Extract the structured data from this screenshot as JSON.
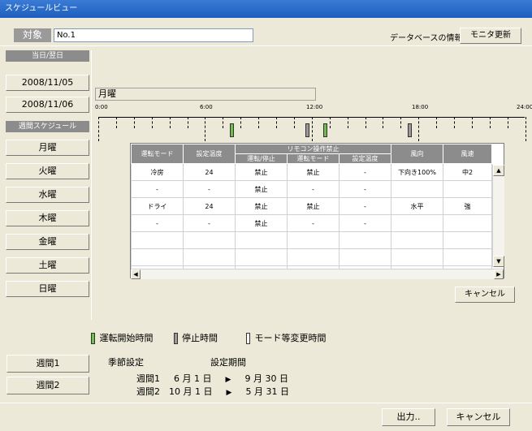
{
  "window": {
    "title": "スケジュールビュー"
  },
  "toolbar": {
    "target_label": "対象",
    "target_value": "No.1",
    "db_info_label": "データベースの情報",
    "monitor_update_label": "モニタ更新"
  },
  "sidebar": {
    "date_header": "当日/翌日",
    "dates": [
      "2008/11/05",
      "2008/11/06"
    ],
    "week_header": "週間スケジュール",
    "days": [
      "月曜",
      "火曜",
      "水曜",
      "木曜",
      "金曜",
      "土曜",
      "日曜"
    ]
  },
  "main": {
    "selected_day": "月曜",
    "timeline": {
      "labels": [
        "0:00",
        "6:00",
        "12:00",
        "18:00",
        "24:00"
      ],
      "start_markers_hours": [
        7.5,
        12.75
      ],
      "stop_markers_hours": [
        11.75,
        17.5
      ]
    },
    "table": {
      "headers_top": [
        "運転モード",
        "設定温度",
        "リモコン操作禁止",
        "風向",
        "風速"
      ],
      "headers_sub": [
        "運転/停止",
        "運転モード",
        "設定温度"
      ],
      "rows": [
        [
          "冷房",
          "24",
          "禁止",
          "禁止",
          "-",
          "下向き100%",
          "中2"
        ],
        [
          "-",
          "-",
          "禁止",
          "-",
          "-",
          "",
          ""
        ],
        [
          "ドライ",
          "24",
          "禁止",
          "禁止",
          "-",
          "水平",
          "強"
        ],
        [
          "-",
          "-",
          "禁止",
          "-",
          "-",
          "",
          ""
        ],
        [
          "",
          "",
          "",
          "",
          "",
          "",
          ""
        ],
        [
          "",
          "",
          "",
          "",
          "",
          "",
          ""
        ],
        [
          "",
          "",
          "",
          "",
          "",
          "",
          ""
        ]
      ]
    },
    "cancel_label": "キャンセル"
  },
  "legend": {
    "start": "運転開始時間",
    "stop": "停止時間",
    "mode_change": "モード等変更時間"
  },
  "season": {
    "week1_button": "週間1",
    "week2_button": "週間2",
    "season_label": "季節設定",
    "period_label": "設定期間",
    "rows": [
      {
        "week": "週間1",
        "from_month": "6",
        "from_day": "1",
        "to_month": "9",
        "to_day": "30"
      },
      {
        "week": "週間2",
        "from_month": "10",
        "from_day": "1",
        "to_month": "5",
        "to_day": "31"
      }
    ],
    "month_unit": "月",
    "day_unit": "日"
  },
  "footer": {
    "output_label": "出力..",
    "cancel_label": "キャンセル"
  },
  "colors": {
    "titlebar": "#1e5fbf",
    "start_marker": "#6ebf4a",
    "stop_marker": "#9a9a9a",
    "header_gray": "#8c8c8c"
  }
}
